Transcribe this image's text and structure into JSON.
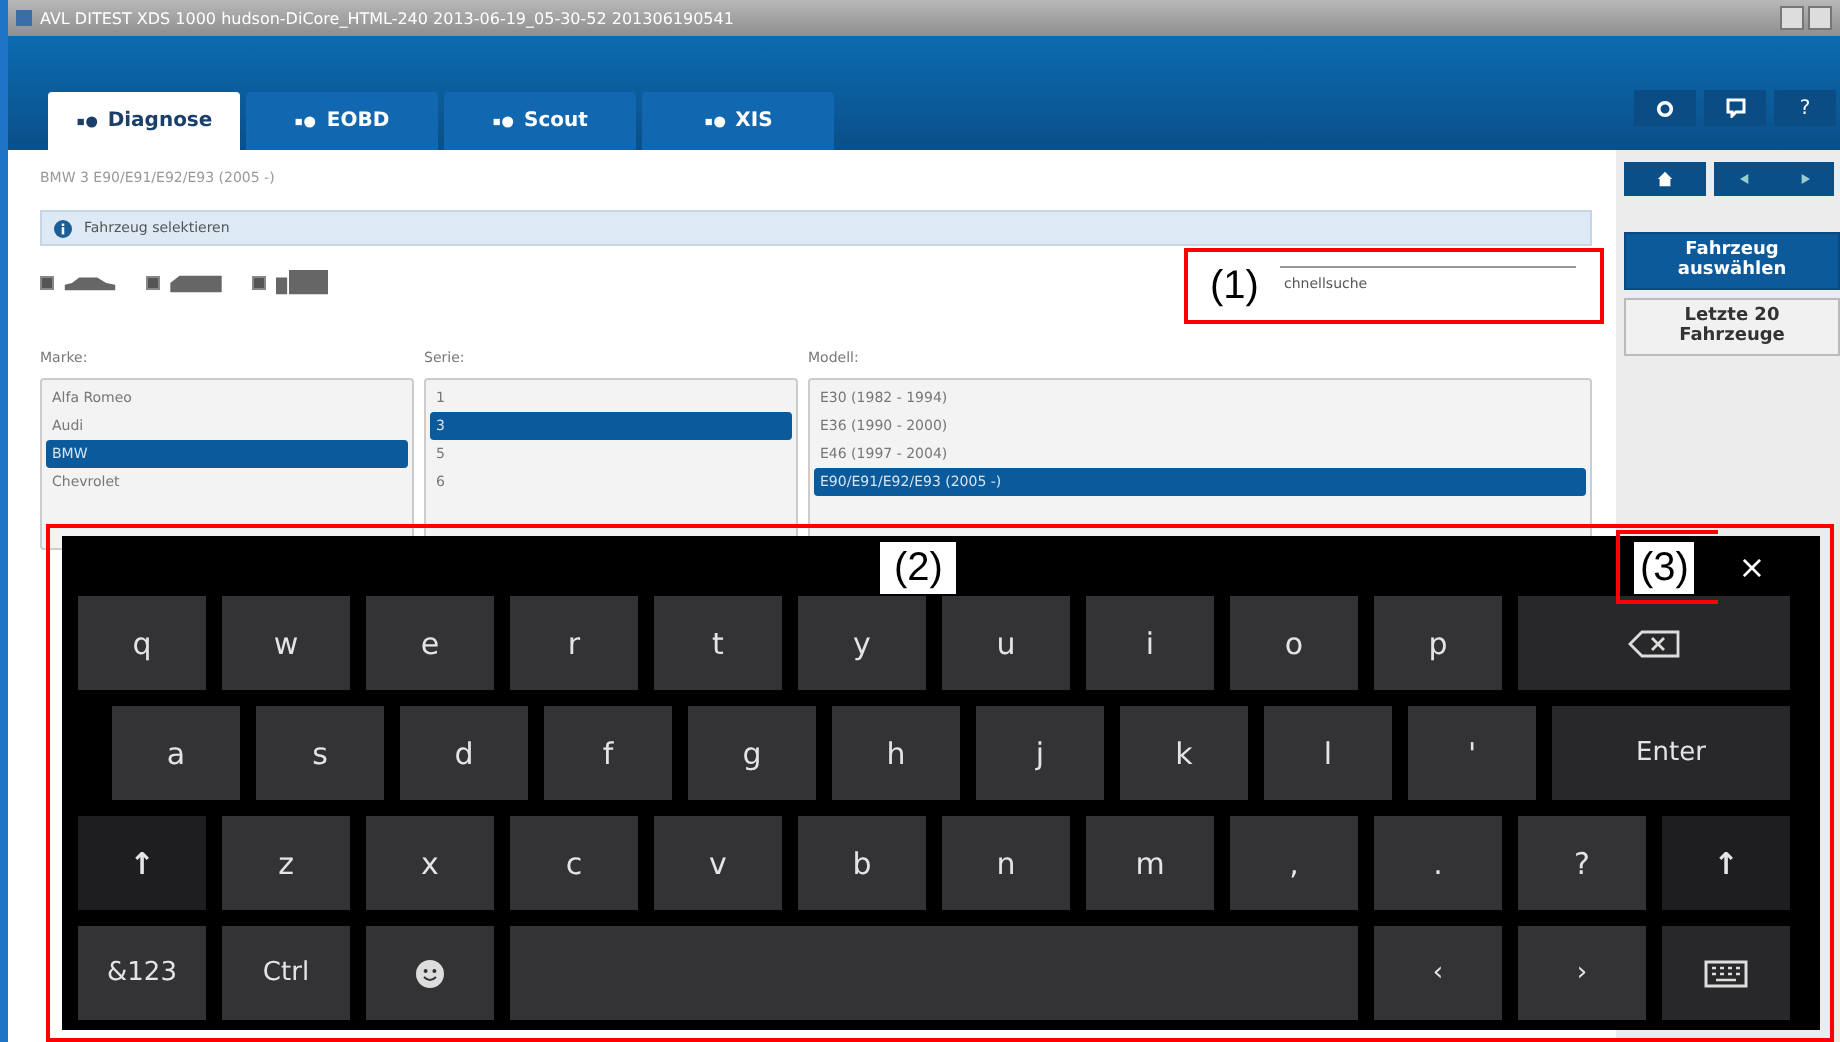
{
  "window": {
    "title": "AVL DITEST XDS 1000 hudson-DiCore_HTML-240 2013-06-19_05-30-52 201306190541"
  },
  "tabs": [
    {
      "label": "Diagnose",
      "selected": true
    },
    {
      "label": "EOBD",
      "selected": false
    },
    {
      "label": "Scout",
      "selected": false
    },
    {
      "label": "XIS",
      "selected": false
    }
  ],
  "header_buttons": [
    {
      "kind": "settings"
    },
    {
      "kind": "feedback"
    },
    {
      "kind": "help",
      "label": "?"
    }
  ],
  "breadcrumb": "BMW 3 E90/E91/E92/E93 (2005 -)",
  "info": "Fahrzeug selektieren",
  "vehicle_filters": [
    {
      "kind": "car",
      "checked": true
    },
    {
      "kind": "van",
      "checked": true
    },
    {
      "kind": "truck",
      "checked": true
    }
  ],
  "quick_search": {
    "placeholder": "chnellsuche"
  },
  "lists": [
    {
      "label": "Marke:",
      "items": [
        {
          "label": "Alfa Romeo",
          "selected": false
        },
        {
          "label": "Audi",
          "selected": false
        },
        {
          "label": "BMW",
          "selected": true
        },
        {
          "label": "Chevrolet",
          "selected": false
        }
      ]
    },
    {
      "label": "Serie:",
      "items": [
        {
          "label": "1",
          "selected": false
        },
        {
          "label": "3",
          "selected": true
        },
        {
          "label": "5",
          "selected": false
        },
        {
          "label": "6",
          "selected": false
        }
      ]
    },
    {
      "label": "Modell:",
      "items": [
        {
          "label": "E30 (1982 - 1994)",
          "selected": false
        },
        {
          "label": "E36 (1990 - 2000)",
          "selected": false
        },
        {
          "label": "E46 (1997 - 2004)",
          "selected": false
        },
        {
          "label": "E90/E91/E92/E93 (2005 -)",
          "selected": true
        }
      ]
    }
  ],
  "sidebar": {
    "nav": [
      {
        "kind": "home"
      },
      {
        "kind": "back"
      },
      {
        "kind": "forward"
      }
    ],
    "buttons": [
      {
        "label": "Fahrzeug auswählen",
        "primary": true
      },
      {
        "label": "Letzte 20 Fahrzeuge",
        "primary": false
      }
    ]
  },
  "keyboard": {
    "rows": [
      {
        "keys": [
          {
            "kind": "char",
            "label": "q"
          },
          {
            "kind": "char",
            "label": "w"
          },
          {
            "kind": "char",
            "label": "e"
          },
          {
            "kind": "char",
            "label": "r"
          },
          {
            "kind": "char",
            "label": "t"
          },
          {
            "kind": "char",
            "label": "y"
          },
          {
            "kind": "char",
            "label": "u"
          },
          {
            "kind": "char",
            "label": "i"
          },
          {
            "kind": "char",
            "label": "o"
          },
          {
            "kind": "char",
            "label": "p"
          },
          {
            "kind": "backspace"
          }
        ]
      },
      {
        "keys": [
          {
            "kind": "char",
            "label": "a"
          },
          {
            "kind": "char",
            "label": "s"
          },
          {
            "kind": "char",
            "label": "d"
          },
          {
            "kind": "char",
            "label": "f"
          },
          {
            "kind": "char",
            "label": "g"
          },
          {
            "kind": "char",
            "label": "h"
          },
          {
            "kind": "char",
            "label": "j"
          },
          {
            "kind": "char",
            "label": "k"
          },
          {
            "kind": "char",
            "label": "l"
          },
          {
            "kind": "char",
            "label": "'"
          },
          {
            "kind": "enter",
            "label": "Enter"
          }
        ]
      },
      {
        "keys": [
          {
            "kind": "shift",
            "label": "↑"
          },
          {
            "kind": "char",
            "label": "z"
          },
          {
            "kind": "char",
            "label": "x"
          },
          {
            "kind": "char",
            "label": "c"
          },
          {
            "kind": "char",
            "label": "v"
          },
          {
            "kind": "char",
            "label": "b"
          },
          {
            "kind": "char",
            "label": "n"
          },
          {
            "kind": "char",
            "label": "m"
          },
          {
            "kind": "char",
            "label": ","
          },
          {
            "kind": "char",
            "label": "."
          },
          {
            "kind": "char",
            "label": "?"
          },
          {
            "kind": "shift",
            "label": "↑"
          }
        ]
      },
      {
        "keys": [
          {
            "kind": "char",
            "label": "&123"
          },
          {
            "kind": "char",
            "label": "Ctrl"
          },
          {
            "kind": "emoji"
          },
          {
            "kind": "space"
          },
          {
            "kind": "char",
            "label": "‹"
          },
          {
            "kind": "char",
            "label": "›"
          },
          {
            "kind": "hide"
          }
        ]
      }
    ],
    "close": "×"
  },
  "annotations": [
    {
      "label": "(1)"
    },
    {
      "label": "(2)"
    },
    {
      "label": "(3)"
    }
  ]
}
